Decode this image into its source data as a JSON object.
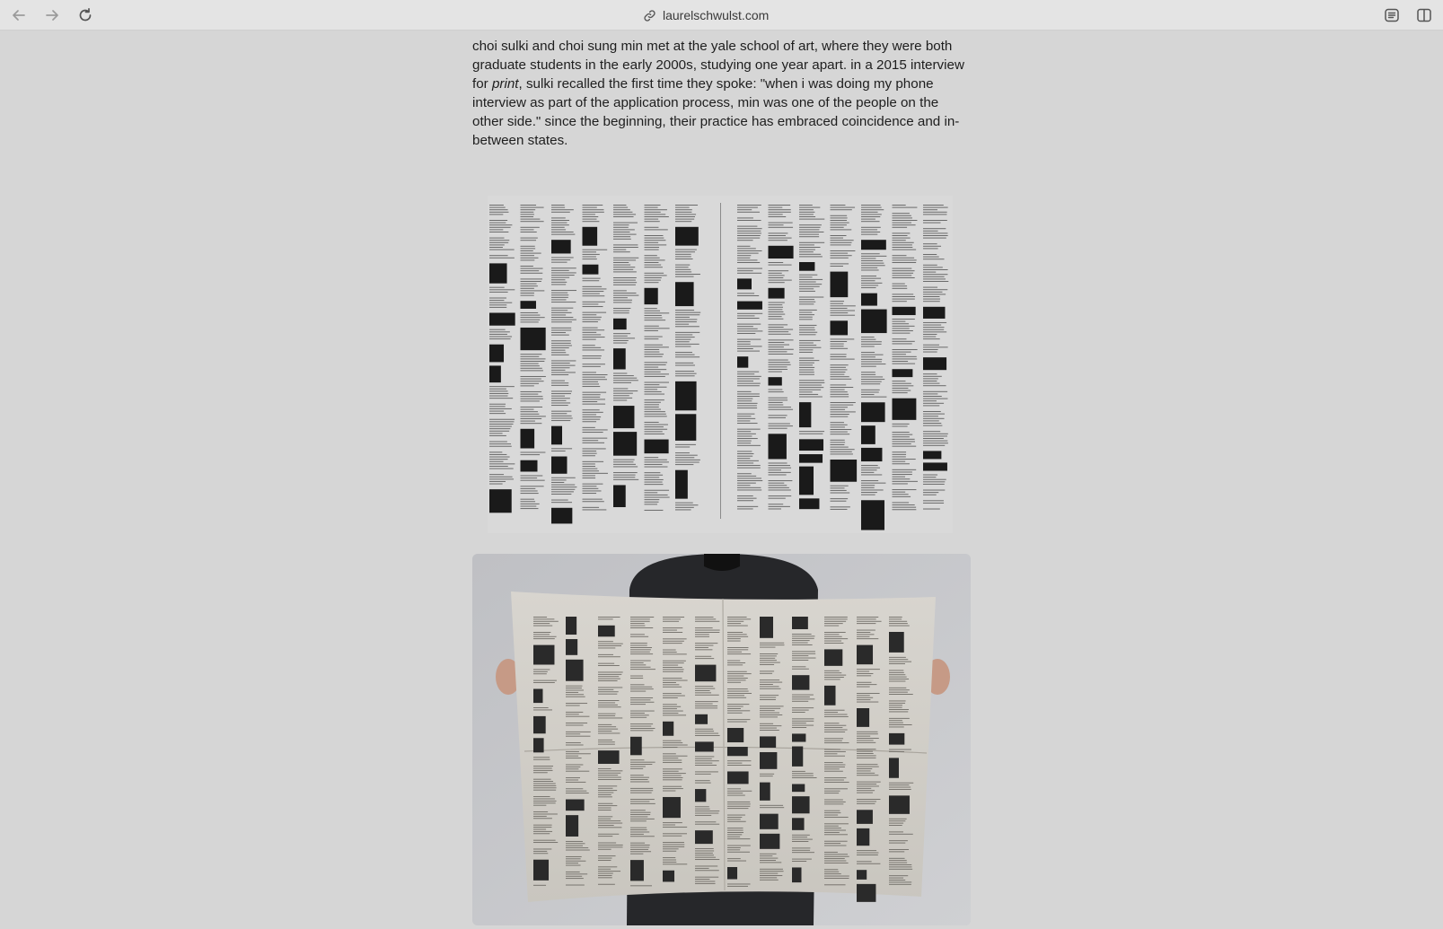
{
  "browser": {
    "url": "laurelschwulst.com",
    "icons": {
      "back": "arrow-left-icon",
      "forward": "arrow-right-icon",
      "reload": "reload-icon",
      "link": "link-icon",
      "reader": "reader-icon",
      "sidebar": "sidebar-icon"
    }
  },
  "article": {
    "para_part1": "choi sulki and choi sung min met at the yale school of art, where they were both graduate students in the early 2000s, studying one year apart. in a 2015 interview for ",
    "para_italic": "print",
    "para_part2": ", sulki recalled the first time they spoke: \"when i was doing my phone interview as part of the application process, min was one of the people on the other side.\" since the beginning, their practice has embraced coincidence and in-between states."
  },
  "colors": {
    "page_bg": "#d6d6d6",
    "toolbar_bg": "#e4e4e4",
    "text": "#1e1e1e"
  }
}
